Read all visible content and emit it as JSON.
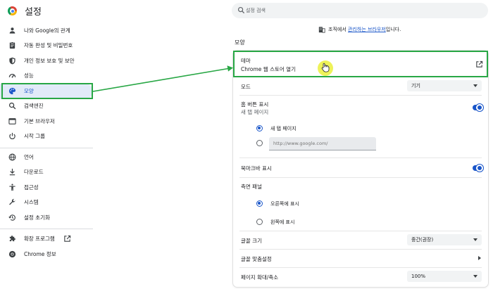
{
  "header": {
    "title": "설정",
    "search_placeholder": "설정 검색"
  },
  "sidebar": {
    "items": [
      {
        "label": "나와 Google의 관계",
        "icon": "person-icon"
      },
      {
        "label": "자동 완성 및 비밀번호",
        "icon": "clipboard-icon"
      },
      {
        "label": "개인 정보 보호 및 보안",
        "icon": "shield-icon"
      },
      {
        "label": "성능",
        "icon": "speedometer-icon"
      },
      {
        "label": "모양",
        "icon": "palette-icon",
        "active": true
      },
      {
        "label": "검색엔진",
        "icon": "search-icon"
      },
      {
        "label": "기본 브라우저",
        "icon": "browser-icon"
      },
      {
        "label": "시작 그룹",
        "icon": "power-icon"
      },
      {
        "label": "언어",
        "icon": "globe-icon"
      },
      {
        "label": "다운로드",
        "icon": "download-icon"
      },
      {
        "label": "접근성",
        "icon": "accessibility-icon"
      },
      {
        "label": "시스템",
        "icon": "wrench-icon"
      },
      {
        "label": "설정 초기화",
        "icon": "history-icon"
      },
      {
        "label": "확장 프로그램",
        "icon": "puzzle-icon"
      },
      {
        "label": "Chrome 정보",
        "icon": "chrome-icon"
      }
    ]
  },
  "managed": {
    "prefix": "조직에서 ",
    "link": "관리하는 브라우저",
    "suffix": "입니다."
  },
  "appearance": {
    "section_title": "모양",
    "theme": {
      "label": "테마",
      "sublabel": "Chrome 웹 스토어 열기"
    },
    "mode": {
      "label": "모드",
      "value": "기기"
    },
    "home_button": {
      "label": "홈 버튼 표시",
      "sublabel": "새 탭 페이지",
      "enabled": true
    },
    "home_options": [
      {
        "label": "새 탭 페이지",
        "selected": true
      },
      {
        "label": "",
        "selected": false
      }
    ],
    "home_url_placeholder": "http://www.google.com/",
    "bookmarks_bar": {
      "label": "북마크바 표시",
      "enabled": true
    },
    "side_panel": {
      "label": "측면 패널"
    },
    "side_panel_options": [
      {
        "label": "오른쪽에 표시",
        "selected": true
      },
      {
        "label": "왼쪽에 표시",
        "selected": false
      }
    ],
    "font_size": {
      "label": "글꼴 크기",
      "value": "중간(권장)"
    },
    "customize_fonts": {
      "label": "글꼴 맞춤설정"
    },
    "page_zoom": {
      "label": "페이지 확대/축소",
      "value": "100%"
    }
  },
  "colors": {
    "accent": "#1a56c9",
    "annotation_green": "#28a745",
    "active_nav_bg": "#e1eaf8",
    "cursor_highlight": "#ebf03c"
  }
}
